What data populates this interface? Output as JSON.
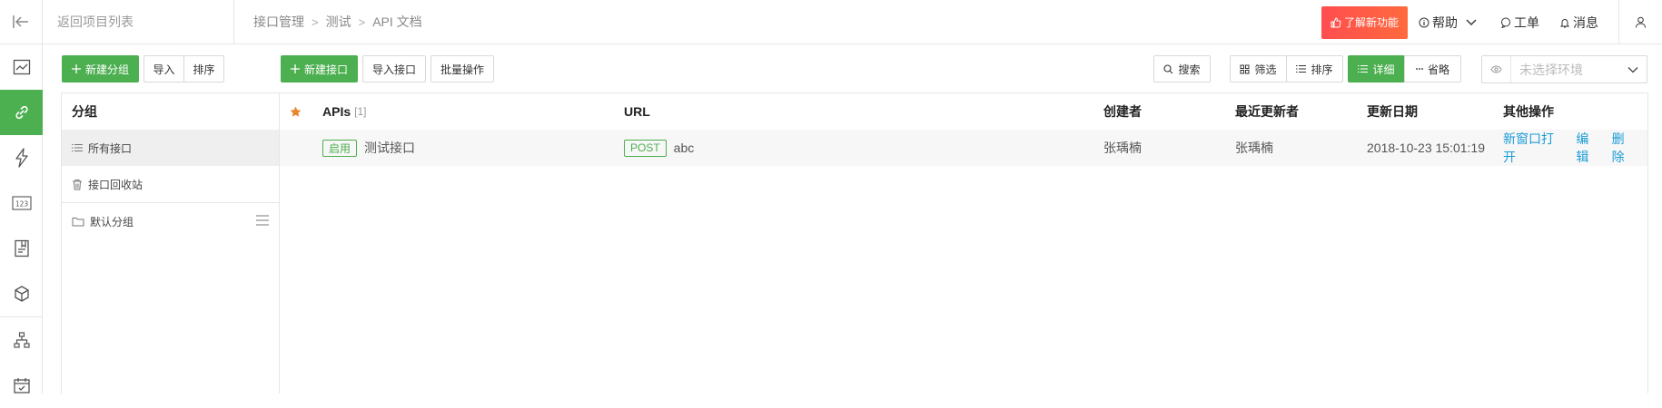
{
  "header": {
    "back_label": "返回项目列表",
    "breadcrumb": [
      "接口管理",
      "测试",
      "API 文档"
    ],
    "feature_label": "了解新功能",
    "help_label": "帮助",
    "ticket_label": "工单",
    "message_label": "消息"
  },
  "rail": {
    "icons": [
      "chart-icon",
      "api-link-icon",
      "lightning-icon",
      "number-icon",
      "document-icon",
      "cube-icon",
      "sitemap-icon",
      "calendar-icon"
    ],
    "active": "api-link-icon",
    "accent_color": "#4caf50"
  },
  "toolbar": {
    "new_group": "新建分组",
    "import": "导入",
    "sort": "排序",
    "new_api": "新建接口",
    "import_api": "导入接口",
    "batch": "批量操作",
    "search": "搜索",
    "filter": "筛选",
    "sort2": "排序",
    "detail": "详细",
    "brief": "省略",
    "env_placeholder": "未选择环境"
  },
  "groups": {
    "title": "分组",
    "all": "所有接口",
    "trash": "接口回收站",
    "default": "默认分组"
  },
  "table": {
    "columns": {
      "apis": "APIs",
      "apis_count": "[1]",
      "url": "URL",
      "creator": "创建者",
      "updater": "最近更新者",
      "updated": "更新日期",
      "actions": "其他操作"
    },
    "rows": [
      {
        "status": "启用",
        "name": "测试接口",
        "method": "POST",
        "url": "abc",
        "creator": "张瑀楠",
        "updater": "张瑀楠",
        "updated": "2018-10-23 15:01:19",
        "open_new": "新窗口打开",
        "edit": "编辑",
        "delete": "删除"
      }
    ]
  }
}
